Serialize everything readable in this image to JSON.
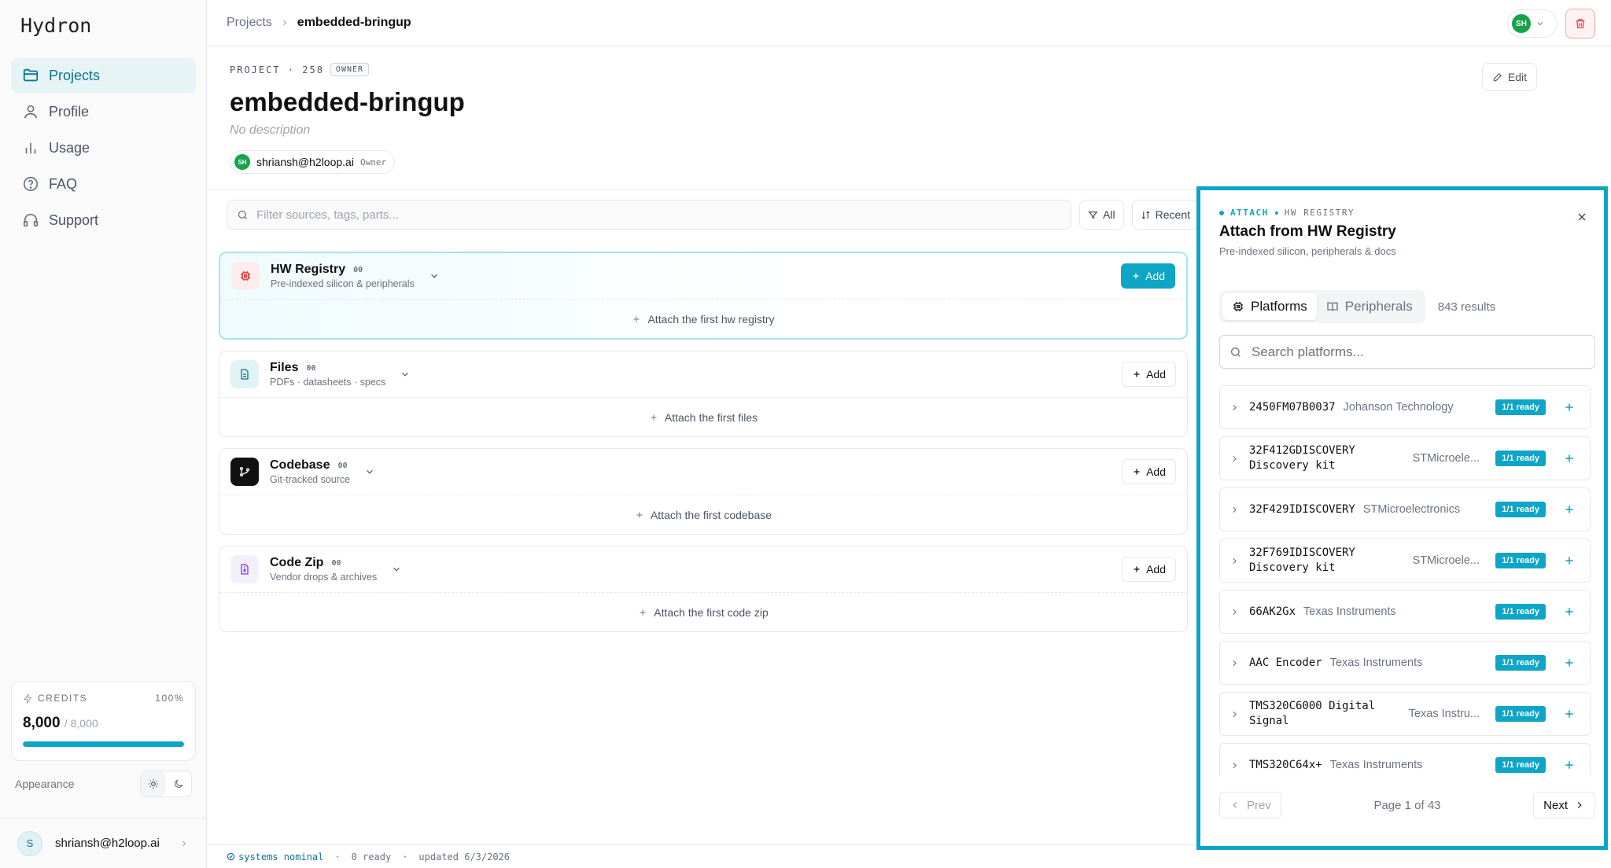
{
  "app": {
    "logo": "Hydron"
  },
  "sidebar": {
    "items": [
      {
        "label": "Projects",
        "icon": "folder-icon",
        "active": true
      },
      {
        "label": "Profile",
        "icon": "user-icon"
      },
      {
        "label": "Usage",
        "icon": "bar-chart-icon"
      },
      {
        "label": "FAQ",
        "icon": "help-icon"
      },
      {
        "label": "Support",
        "icon": "headphones-icon"
      }
    ],
    "credits": {
      "label": "CREDITS",
      "percent": "100%",
      "value": "8,000",
      "total": "/ 8,000",
      "fill": 1.0
    },
    "appearance": "Appearance",
    "user": {
      "initial": "S",
      "email": "shriansh@h2loop.ai"
    }
  },
  "header": {
    "breadcrumb": {
      "root": "Projects",
      "current": "embedded-bringup"
    },
    "avatar": "SH"
  },
  "project": {
    "meta": "PROJECT · 258",
    "owner_tag": "OWNER",
    "title": "embedded-bringup",
    "description": "No description",
    "member": {
      "initials": "SH",
      "email": "shriansh@h2loop.ai",
      "role": "Owner"
    },
    "edit_label": "Edit"
  },
  "filter": {
    "placeholder": "Filter sources, tags, parts...",
    "all_label": "All",
    "recent_label": "Recent"
  },
  "sources": [
    {
      "name": "HW Registry",
      "count": "00",
      "sub": "Pre-indexed silicon & peripherals",
      "add": "Add",
      "attach": "Attach the first hw registry"
    },
    {
      "name": "Files",
      "count": "00",
      "sub": "PDFs · datasheets · specs",
      "add": "Add",
      "attach": "Attach the first files"
    },
    {
      "name": "Codebase",
      "count": "00",
      "sub": "Git-tracked source",
      "add": "Add",
      "attach": "Attach the first codebase"
    },
    {
      "name": "Code Zip",
      "count": "00",
      "sub": "Vendor drops & archives",
      "add": "Add",
      "attach": "Attach the first code zip"
    }
  ],
  "status": {
    "nominal": "systems nominal",
    "ready": "0 ready",
    "updated": "updated 6/3/2026"
  },
  "panel": {
    "kicker_a": "ATTACH",
    "kicker_b": "HW REGISTRY",
    "title": "Attach from HW Registry",
    "subtitle": "Pre-indexed silicon, peripherals & docs",
    "tabs": [
      {
        "label": "Platforms"
      },
      {
        "label": "Peripherals"
      }
    ],
    "results": "843 results",
    "search_placeholder": "Search platforms...",
    "items": [
      {
        "name1": "2450FM07B0037",
        "name2": "",
        "vendor": "Johanson Technology",
        "badge": "1/1 ready"
      },
      {
        "name1": "32F412GDISCOVERY",
        "name2": "Discovery kit",
        "vendor": "STMicroele...",
        "badge": "1/1 ready"
      },
      {
        "name1": "32F429IDISCOVERY",
        "name2": "",
        "vendor": "STMicroelectronics",
        "badge": "1/1 ready"
      },
      {
        "name1": "32F769IDISCOVERY",
        "name2": "Discovery kit",
        "vendor": "STMicroele...",
        "badge": "1/1 ready"
      },
      {
        "name1": "66AK2Gx",
        "name2": "",
        "vendor": "Texas Instruments",
        "badge": "1/1 ready"
      },
      {
        "name1": "AAC Encoder",
        "name2": "",
        "vendor": "Texas Instruments",
        "badge": "1/1 ready"
      },
      {
        "name1": "TMS320C6000 Digital",
        "name2": "Signal",
        "vendor": "Texas Instru...",
        "badge": "1/1 ready"
      },
      {
        "name1": "TMS320C64x+",
        "name2": "",
        "vendor": "Texas Instruments",
        "badge": "1/1 ready"
      }
    ],
    "prev": "Prev",
    "page": "Page 1 of 43",
    "next": "Next"
  }
}
